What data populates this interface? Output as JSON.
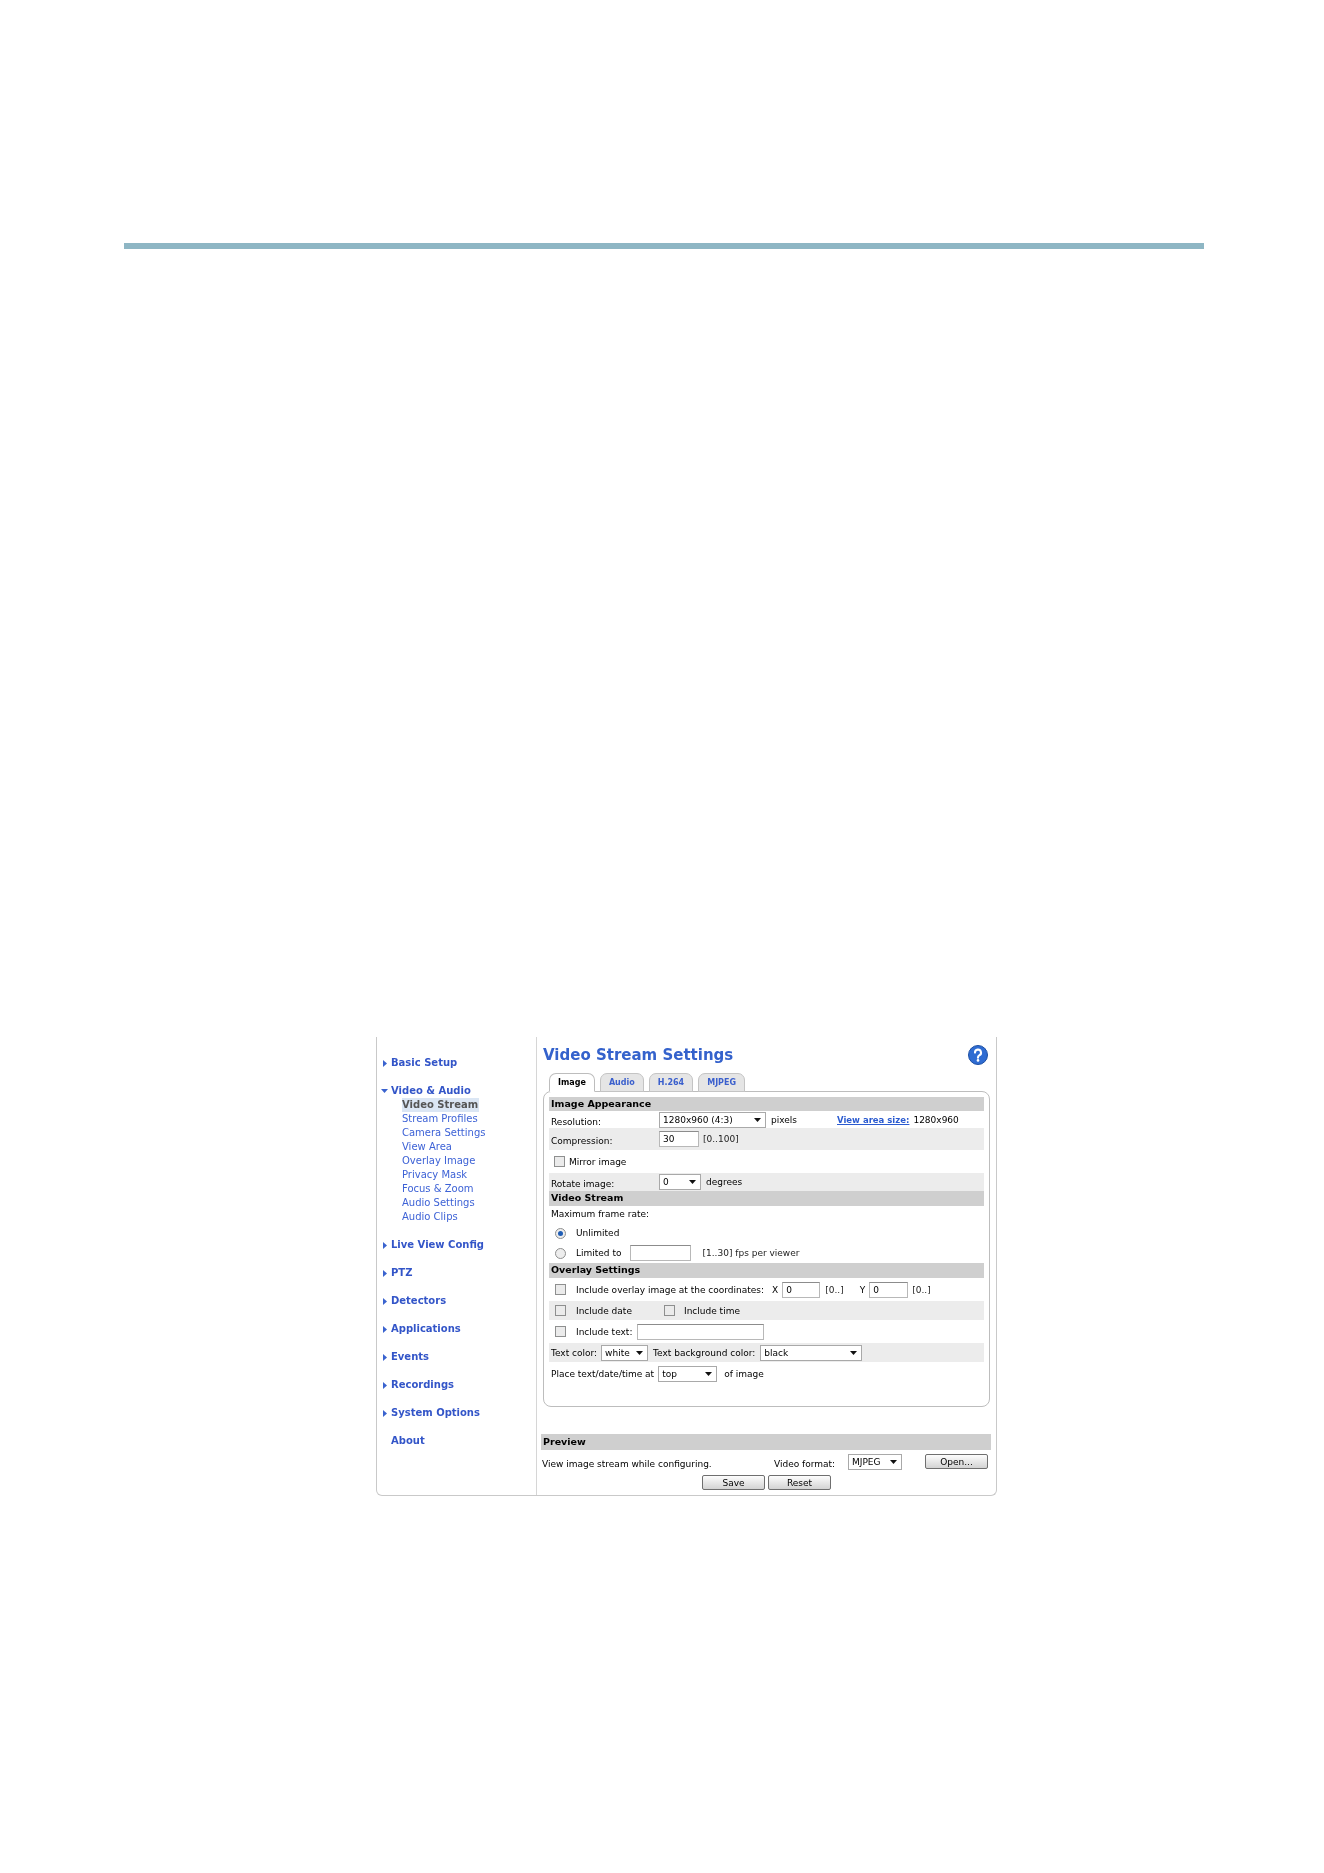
{
  "sidebar": {
    "items": [
      {
        "label": "Basic Setup",
        "kind": "group",
        "expanded": false
      },
      {
        "label": "Video & Audio",
        "kind": "group",
        "expanded": true,
        "children": [
          {
            "label": "Video Stream",
            "selected": true
          },
          {
            "label": "Stream Profiles",
            "selected": false
          },
          {
            "label": "Camera Settings",
            "selected": false
          },
          {
            "label": "View Area",
            "selected": false
          },
          {
            "label": "Overlay Image",
            "selected": false
          },
          {
            "label": "Privacy Mask",
            "selected": false
          },
          {
            "label": "Focus & Zoom",
            "selected": false
          },
          {
            "label": "Audio Settings",
            "selected": false
          },
          {
            "label": "Audio Clips",
            "selected": false
          }
        ]
      },
      {
        "label": "Live View Config",
        "kind": "group",
        "expanded": false
      },
      {
        "label": "PTZ",
        "kind": "group",
        "expanded": false
      },
      {
        "label": "Detectors",
        "kind": "group",
        "expanded": false
      },
      {
        "label": "Applications",
        "kind": "group",
        "expanded": false
      },
      {
        "label": "Events",
        "kind": "group",
        "expanded": false
      },
      {
        "label": "Recordings",
        "kind": "group",
        "expanded": false
      },
      {
        "label": "System Options",
        "kind": "group",
        "expanded": false
      },
      {
        "label": "About",
        "kind": "link"
      }
    ]
  },
  "title": "Video Stream Settings",
  "tabs": [
    {
      "label": "Image",
      "selected": true
    },
    {
      "label": "Audio",
      "selected": false
    },
    {
      "label": "H.264",
      "selected": false
    },
    {
      "label": "MJPEG",
      "selected": false
    }
  ],
  "image_appearance": {
    "title": "Image Appearance",
    "resolution": {
      "label": "Resolution:",
      "value": "1280x960 (4:3)",
      "unit": "pixels",
      "link": "View area size:",
      "view_area_size": "1280x960"
    },
    "compression": {
      "label": "Compression:",
      "value": "30",
      "range": "[0..100]"
    },
    "mirror_image": {
      "label": "Mirror image",
      "checked": false
    },
    "rotate_image": {
      "label": "Rotate image:",
      "value": "0",
      "unit": "degrees"
    }
  },
  "video_stream": {
    "title": "Video Stream",
    "label": "Maximum frame rate:",
    "options": [
      {
        "label": "Unlimited",
        "selected": true
      },
      {
        "label": "Limited to",
        "selected": false,
        "range": "[1..30] fps per viewer"
      }
    ]
  },
  "overlay_settings": {
    "title": "Overlay Settings",
    "include_overlay_image": {
      "label": "Include overlay image at the coordinates:",
      "checked": false,
      "x_label": "X",
      "x_value": "0",
      "x_range": "[0..]",
      "y_label": "Y",
      "y_value": "0",
      "y_range": "[0..]"
    },
    "include_date": {
      "label": "Include date",
      "checked": false
    },
    "include_time": {
      "label": "Include time",
      "checked": false
    },
    "include_text": {
      "label": "Include text:",
      "checked": false
    },
    "text_color": {
      "label": "Text color:",
      "value": "white"
    },
    "text_background_color": {
      "label": "Text background color:",
      "value": "black"
    },
    "placement": {
      "label": "Place text/date/time at",
      "value": "top",
      "suffix": "of image"
    }
  },
  "preview": {
    "title": "Preview",
    "description": "View image stream while configuring.",
    "video_format_label": "Video format:",
    "video_format": "MJPEG",
    "open_button": "Open..."
  },
  "buttons": [
    "Save",
    "Reset"
  ]
}
